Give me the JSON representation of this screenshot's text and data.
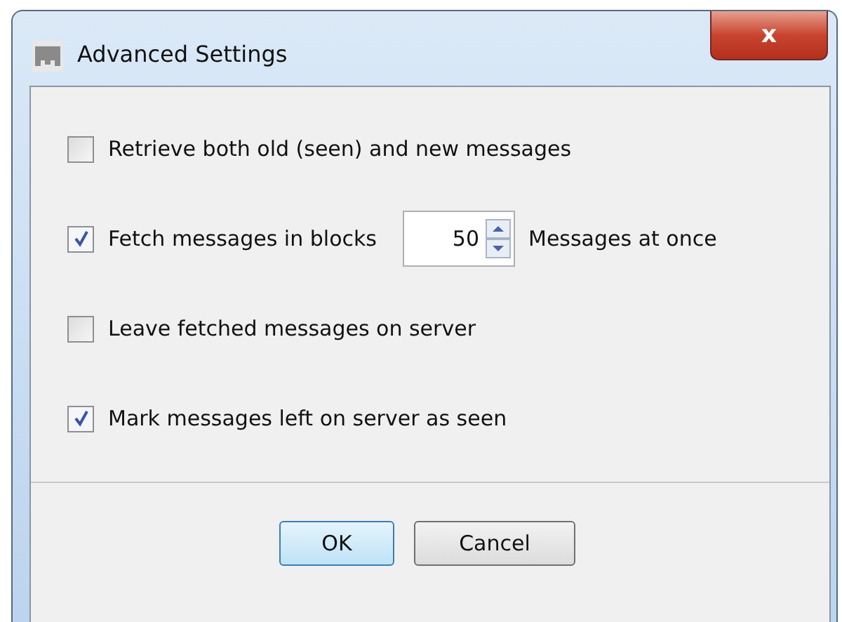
{
  "window": {
    "title": "Advanced Settings",
    "close_label": "x"
  },
  "options": [
    {
      "kind": "checkbox",
      "label": "Retrieve both old (seen) and new messages",
      "checked": false
    },
    {
      "kind": "spinner",
      "label": "Fetch messages in blocks",
      "checked": true,
      "value": "50",
      "suffix": "Messages at once"
    },
    {
      "kind": "checkbox",
      "label": "Leave fetched messages on server",
      "checked": false
    },
    {
      "kind": "checkbox",
      "label": "Mark messages left on server as seen",
      "checked": true
    }
  ],
  "buttons": [
    {
      "label": "OK",
      "default": true
    },
    {
      "label": "Cancel",
      "default": false
    }
  ]
}
